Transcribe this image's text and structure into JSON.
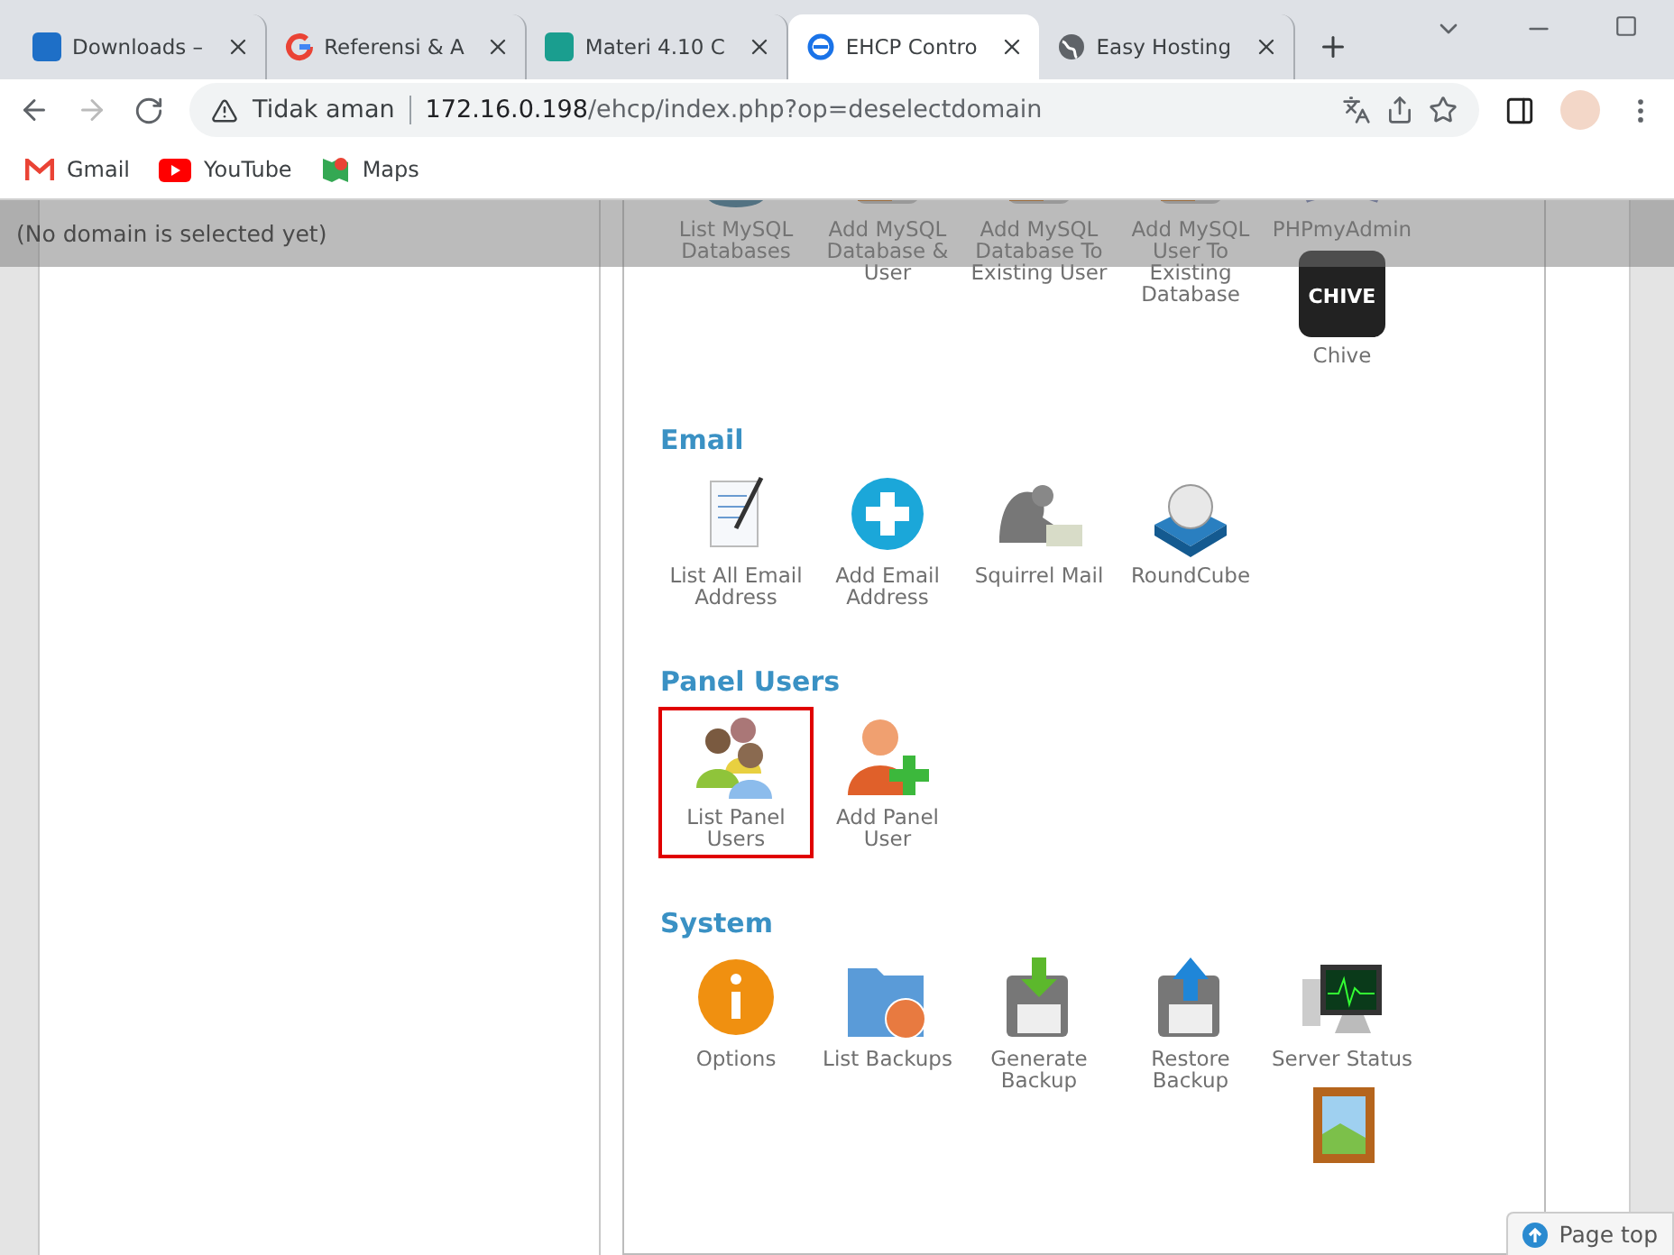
{
  "browser": {
    "tabs": [
      {
        "title": "Downloads –",
        "selected": false
      },
      {
        "title": "Referensi & A",
        "selected": false
      },
      {
        "title": "Materi 4.10 C",
        "selected": false
      },
      {
        "title": "EHCP Contro",
        "selected": true
      },
      {
        "title": "Easy Hosting",
        "selected": false
      }
    ],
    "address": {
      "security": "Tidak aman",
      "host": "172.16.0.198",
      "path": "/ehcp/index.php?op=deselectdomain"
    },
    "bookmarks": [
      {
        "label": "Gmail"
      },
      {
        "label": "YouTube"
      },
      {
        "label": "Maps"
      }
    ]
  },
  "page": {
    "notice": "(No domain is selected yet)",
    "sections": [
      {
        "items": [
          {
            "kind": "mysql",
            "label": "List MySQL Databases",
            "highlighted": false
          },
          {
            "kind": "sql",
            "label": "Add MySQL Database & User",
            "highlighted": false
          },
          {
            "kind": "sql",
            "label": "Add MySQL Database To Existing User",
            "highlighted": false
          },
          {
            "kind": "sql",
            "label": "Add MySQL User To Existing Database",
            "highlighted": false
          },
          {
            "kind": "phpmyadmin",
            "label": "PHPmyAdmin",
            "highlighted": false
          },
          {
            "kind": "chive",
            "logo_text": "CHIVE",
            "label": "Chive",
            "highlighted": false
          }
        ]
      },
      {
        "heading": "Email",
        "items": [
          {
            "kind": "document",
            "label": "List All Email Address",
            "highlighted": false
          },
          {
            "kind": "plus",
            "label": "Add Email Address",
            "highlighted": false
          },
          {
            "kind": "squirrel",
            "label": "Squirrel Mail",
            "highlighted": false
          },
          {
            "kind": "roundcube",
            "label": "RoundCube",
            "highlighted": false
          }
        ]
      },
      {
        "heading": "Panel Users",
        "items": [
          {
            "kind": "users",
            "label": "List Panel Users",
            "highlighted": true
          },
          {
            "kind": "user-add",
            "label": "Add Panel User",
            "highlighted": false
          }
        ]
      },
      {
        "heading": "System",
        "items": [
          {
            "kind": "info",
            "label": "Options",
            "highlighted": false
          },
          {
            "kind": "folder",
            "label": "List Backups",
            "highlighted": false
          },
          {
            "kind": "floppy-down",
            "label": "Generate Backup",
            "highlighted": false
          },
          {
            "kind": "floppy-up",
            "label": "Restore Backup",
            "highlighted": false
          },
          {
            "kind": "monitor",
            "label": "Server Status",
            "highlighted": false
          },
          {
            "kind": "picture",
            "highlighted": false
          }
        ]
      }
    ],
    "page_top": "Page top"
  }
}
